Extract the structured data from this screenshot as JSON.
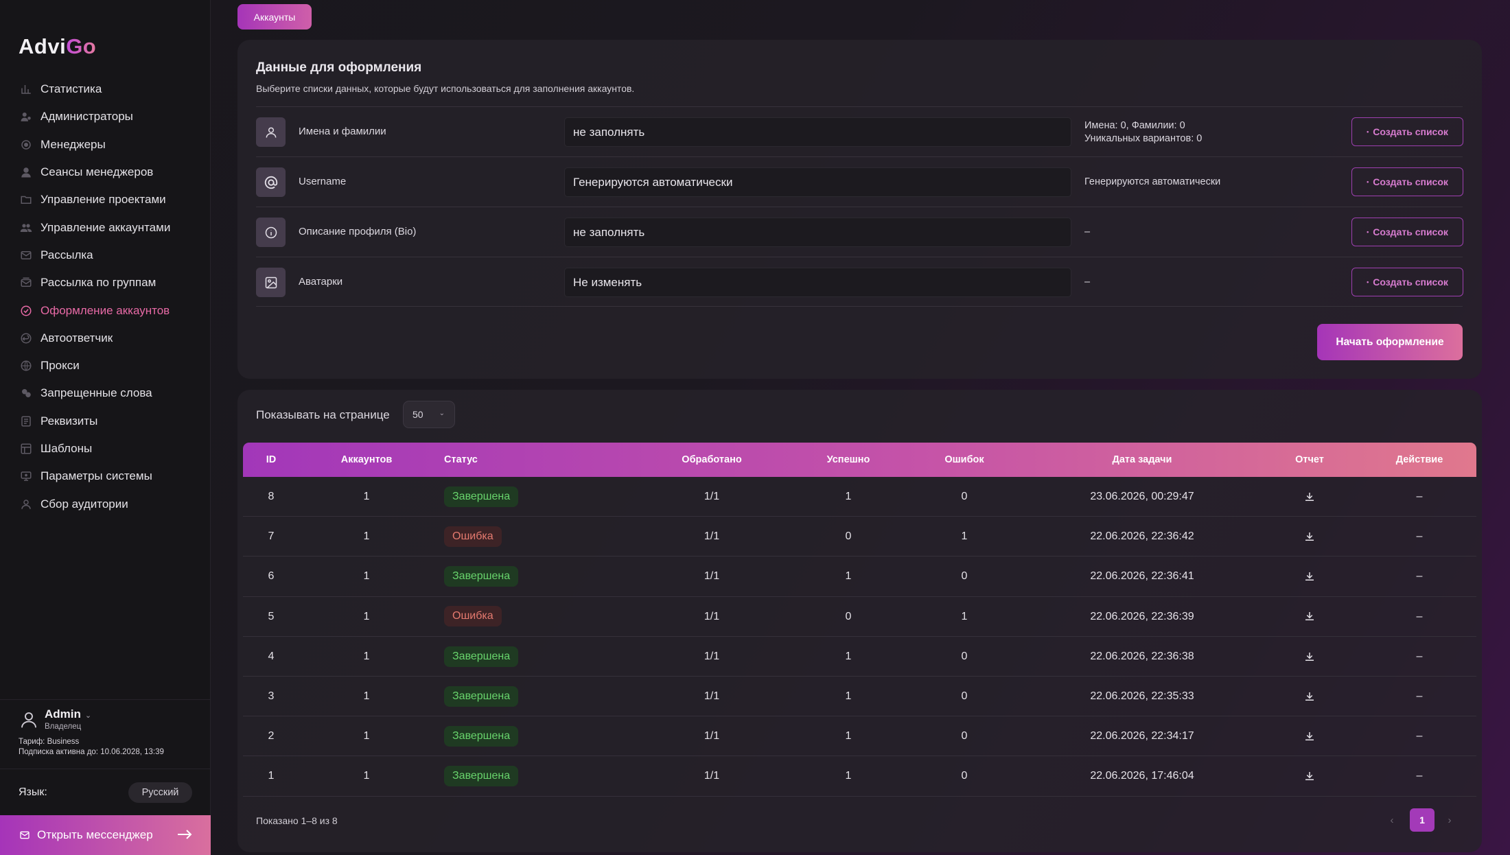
{
  "app": {
    "logo_main": "Advi",
    "logo_accent": "Go",
    "brand_color": "#a535b8",
    "accent_color": "#e86aa6"
  },
  "top_tab": {
    "label": "Аккаунты"
  },
  "sidebar": {
    "items": [
      {
        "label": "Статистика",
        "icon": "chart-icon",
        "active": false
      },
      {
        "label": "Администраторы",
        "icon": "admins-icon",
        "active": false
      },
      {
        "label": "Менеджеры",
        "icon": "managers-icon",
        "active": false
      },
      {
        "label": "Сеансы менеджеров",
        "icon": "sessions-icon",
        "active": false
      },
      {
        "label": "Управление проектами",
        "icon": "projects-icon",
        "active": false
      },
      {
        "label": "Управление аккаунтами",
        "icon": "accounts-icon",
        "active": false
      },
      {
        "label": "Рассылка",
        "icon": "mailing-icon",
        "active": false
      },
      {
        "label": "Рассылка по группам",
        "icon": "group-mailing-icon",
        "active": false
      },
      {
        "label": "Оформление аккаунтов",
        "icon": "check-circle-icon",
        "active": true
      },
      {
        "label": "Автоответчик",
        "icon": "autoreply-icon",
        "active": false
      },
      {
        "label": "Прокси",
        "icon": "proxy-icon",
        "active": false
      },
      {
        "label": "Запрещенные слова",
        "icon": "banned-words-icon",
        "active": false
      },
      {
        "label": "Реквизиты",
        "icon": "requisites-icon",
        "active": false
      },
      {
        "label": "Шаблоны",
        "icon": "templates-icon",
        "active": false
      },
      {
        "label": "Параметры системы",
        "icon": "settings-icon",
        "active": false
      },
      {
        "label": "Сбор аудитории",
        "icon": "audience-icon",
        "active": false
      }
    ],
    "user": {
      "name": "Admin",
      "role": "Владелец",
      "tariff": "Тариф: Business",
      "subscription": "Подписка активна до: 10.06.2028, 13:39"
    },
    "language": {
      "label": "Язык:",
      "value": "Русский"
    },
    "messenger_button": "Открыть мессенджер"
  },
  "design": {
    "title": "Данные для оформления",
    "subtitle": "Выберите списки данных, которые будут использоваться для заполнения аккаунтов.",
    "rows": [
      {
        "label": "Имена и фамилии",
        "icon": "user-icon",
        "value": "не заполнять",
        "info": "Имена: 0, Фамилии: 0",
        "info2": "Уникальных вариантов: 0",
        "button": "Создать список"
      },
      {
        "label": "Username",
        "icon": "at-icon",
        "value": "Генерируются автоматически",
        "info": "Генерируются автоматически",
        "info2": "",
        "button": "Создать список"
      },
      {
        "label": "Описание профиля (Bio)",
        "icon": "info-icon",
        "value": "не заполнять",
        "info": "–",
        "info2": "",
        "button": "Создать список"
      },
      {
        "label": "Аватарки",
        "icon": "image-icon",
        "value": "Не изменять",
        "info": "–",
        "info2": "",
        "button": "Создать список"
      }
    ],
    "start_button": "Начать оформление"
  },
  "tasks": {
    "per_page_label": "Показывать на странице",
    "per_page_value": "50",
    "columns": [
      "ID",
      "Аккаунтов",
      "Статус",
      "Обработано",
      "Успешно",
      "Ошибок",
      "Дата задачи",
      "Отчет",
      "Действие"
    ],
    "rows": [
      {
        "id": "8",
        "accounts": "1",
        "status": "Завершена",
        "status_type": "ok",
        "processed": "1/1",
        "success": "1",
        "errors": "0",
        "date": "23.06.2026, 00:29:47",
        "action": "–"
      },
      {
        "id": "7",
        "accounts": "1",
        "status": "Ошибка",
        "status_type": "err",
        "processed": "1/1",
        "success": "0",
        "errors": "1",
        "date": "22.06.2026, 22:36:42",
        "action": "–"
      },
      {
        "id": "6",
        "accounts": "1",
        "status": "Завершена",
        "status_type": "ok",
        "processed": "1/1",
        "success": "1",
        "errors": "0",
        "date": "22.06.2026, 22:36:41",
        "action": "–"
      },
      {
        "id": "5",
        "accounts": "1",
        "status": "Ошибка",
        "status_type": "err",
        "processed": "1/1",
        "success": "0",
        "errors": "1",
        "date": "22.06.2026, 22:36:39",
        "action": "–"
      },
      {
        "id": "4",
        "accounts": "1",
        "status": "Завершена",
        "status_type": "ok",
        "processed": "1/1",
        "success": "1",
        "errors": "0",
        "date": "22.06.2026, 22:36:38",
        "action": "–"
      },
      {
        "id": "3",
        "accounts": "1",
        "status": "Завершена",
        "status_type": "ok",
        "processed": "1/1",
        "success": "1",
        "errors": "0",
        "date": "22.06.2026, 22:35:33",
        "action": "–"
      },
      {
        "id": "2",
        "accounts": "1",
        "status": "Завершена",
        "status_type": "ok",
        "processed": "1/1",
        "success": "1",
        "errors": "0",
        "date": "22.06.2026, 22:34:17",
        "action": "–"
      },
      {
        "id": "1",
        "accounts": "1",
        "status": "Завершена",
        "status_type": "ok",
        "processed": "1/1",
        "success": "1",
        "errors": "0",
        "date": "22.06.2026, 17:46:04",
        "action": "–"
      }
    ],
    "summary": "Показано 1–8 из 8",
    "pagination": {
      "prev": "‹",
      "current": "1",
      "next": "›"
    }
  }
}
